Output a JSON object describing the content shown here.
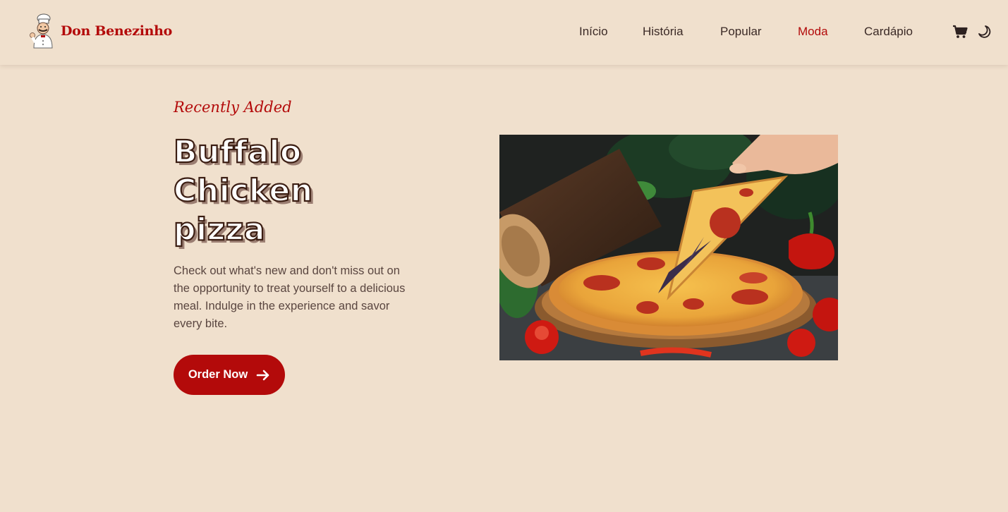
{
  "brand": {
    "name": "Don Benezinho",
    "logo_icon": "chef-mascot-icon",
    "accent": "#b30a0a"
  },
  "nav": {
    "items": [
      {
        "label": "Início",
        "active": false
      },
      {
        "label": "História",
        "active": false
      },
      {
        "label": "Popular",
        "active": false
      },
      {
        "label": "Moda",
        "active": true
      },
      {
        "label": "Cardápio",
        "active": false
      }
    ],
    "cart_icon": "cart-icon",
    "theme_icon": "moon-icon"
  },
  "hero": {
    "eyebrow": "Recently Added",
    "title_lines": [
      "Buffalo",
      "Chicken",
      "pizza"
    ],
    "description": "Check out what's new and don't miss out on the opportunity to treat yourself to a delicious meal. Indulge in the experience and savor every bite.",
    "cta_label": "Order Now",
    "cta_icon": "arrow-right-icon",
    "image_subject": "pizza-photo"
  },
  "colors": {
    "background": "#f0e0cd",
    "accent": "#b30a0a",
    "text": "#3b2a26"
  }
}
